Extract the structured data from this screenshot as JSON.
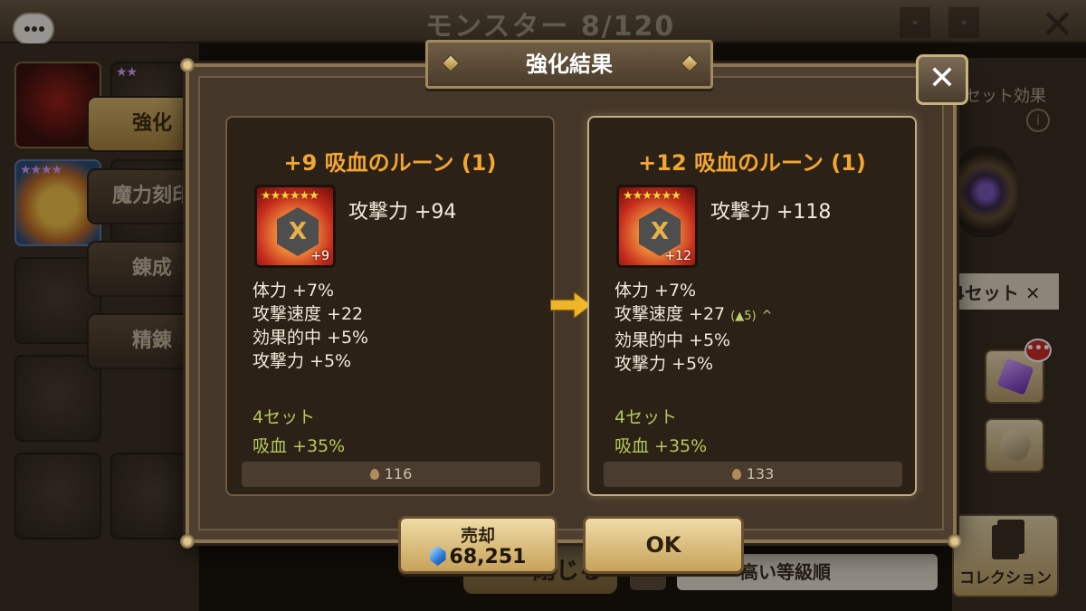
{
  "background": {
    "title": "モンスター 8/120",
    "tabs": [
      {
        "label": "強化",
        "active": true
      },
      {
        "label": "魔力刻印",
        "active": false
      },
      {
        "label": "錬成",
        "active": false
      },
      {
        "label": "精錬",
        "active": false
      }
    ],
    "set_effect_label": "セット効果",
    "set_count_label": "4セット",
    "close_label": "閉じる",
    "sort_label": "高い等級順",
    "collection_label": "コレクション",
    "notification_badge": "•••"
  },
  "modal": {
    "title": "強化結果",
    "close_symbol": "✕",
    "before": {
      "rune_name": "+9 吸血のルーン (1)",
      "stars": "★★★★★★",
      "level": "+9",
      "rune_glyph": "X",
      "main_stat": "攻撃力 +94",
      "substats": [
        "体力 +7%",
        "攻撃速度 +22",
        "効果的中 +5%",
        "攻撃力 +5%"
      ],
      "set_name": "4セット",
      "set_effect": "吸血 +35%",
      "sell_value": "116"
    },
    "after": {
      "rune_name": "+12 吸血のルーン (1)",
      "stars": "★★★★★★",
      "level": "+12",
      "rune_glyph": "X",
      "main_stat": "攻撃力 +118",
      "substats": [
        "体力 +7%",
        "攻撃速度 +27",
        "効果的中 +5%",
        "攻撃力 +5%"
      ],
      "upgrade_note": "(▲5)",
      "upgrade_caret": "^",
      "set_name": "4セット",
      "set_effect": "吸血 +35%",
      "sell_value": "133"
    },
    "sell_button": {
      "label": "売却",
      "price": "68,251"
    },
    "ok_button": {
      "label": "OK"
    }
  },
  "colors": {
    "rune_title": "#f2a531",
    "set_text": "#b4c85a",
    "arrow": "#f0b428",
    "button_gold": "#d9bb74"
  }
}
